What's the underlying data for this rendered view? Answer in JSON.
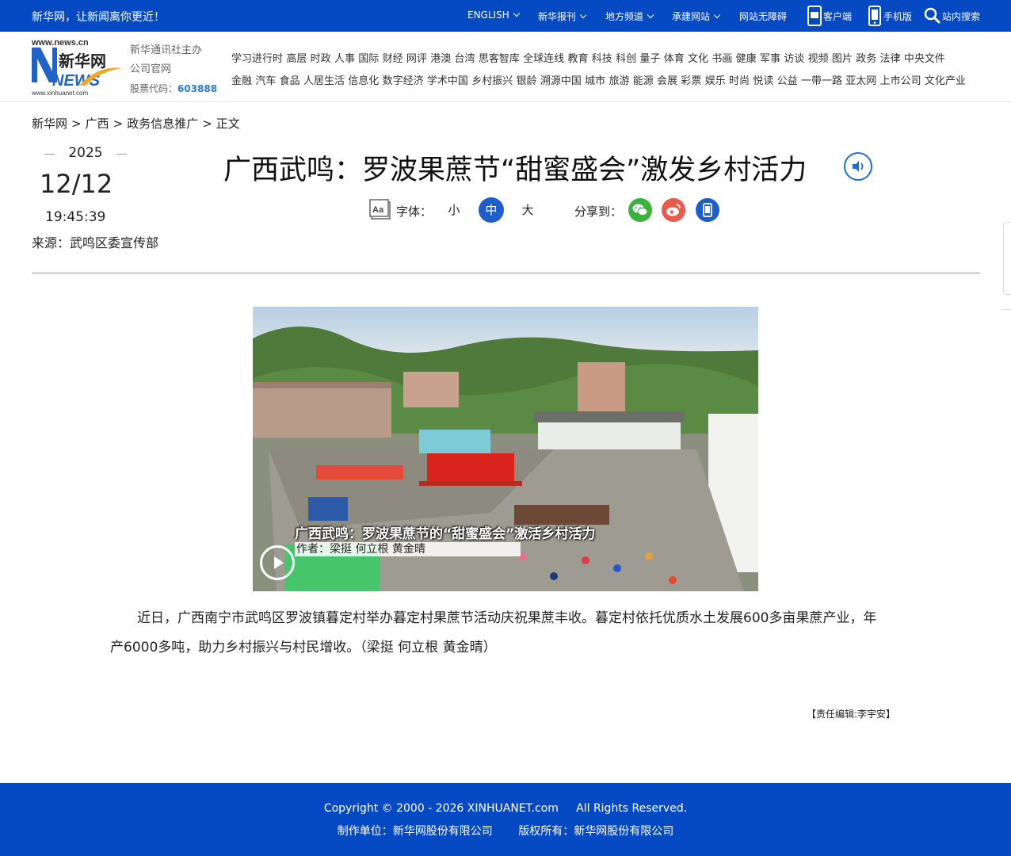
{
  "topbar": {
    "slogan": "新华网，让新闻离你更近！",
    "links": {
      "english": "ENGLISH",
      "publications": "新华报刊",
      "local": "地方频道",
      "construction": "承建网站",
      "accessible": "网站无障碍",
      "client": "客户端",
      "mobile": "手机版",
      "search": "站内搜索"
    }
  },
  "header": {
    "logo_text": {
      "domain": "www.news.cn",
      "cn": "新华网",
      "en": "NEWS",
      "sub": "www.xinhuanet.com"
    },
    "org_line1": "新华通讯社主办",
    "org_line2": "公司官网",
    "stock_label": "股票代码：",
    "stock_code": "603888",
    "nav_row1": [
      "学习进行时",
      "高层",
      "时政",
      "人事",
      "国际",
      "财经",
      "网评",
      "港澳",
      "台湾",
      "思客智库",
      "全球连线",
      "教育",
      "科技",
      "科创",
      "量子",
      "体育",
      "文化",
      "书画",
      "健康",
      "军事",
      "访谈",
      "视频",
      "图片",
      "政务",
      "法律",
      "中央文件"
    ],
    "nav_row2": [
      "金融",
      "汽车",
      "食品",
      "人居生活",
      "信息化",
      "数字经济",
      "学术中国",
      "乡村振兴",
      "银龄",
      "溯源中国",
      "城市",
      "旅游",
      "能源",
      "会展",
      "彩票",
      "娱乐",
      "时尚",
      "悦读",
      "公益",
      "一带一路",
      "亚太网",
      "上市公司",
      "文化产业"
    ]
  },
  "breadcrumb": {
    "items": [
      "新华网",
      "广西",
      "政务信息推广",
      "正文"
    ],
    "separator": ">"
  },
  "date": {
    "year": "2025",
    "day": "12/12",
    "time": "19:45:39",
    "source": "来源：武鸣区委宣传部"
  },
  "article": {
    "title": "广西武鸣：罗波果蔗节“甜蜜盛会”激发乡村活力",
    "font_label": "字体：",
    "font_small": "小",
    "font_mid": "中",
    "font_big": "大",
    "share_label": "分享到：",
    "video_caption": "广西武鸣：罗波果蔗节的“甜蜜盛会”激活乡村活力",
    "video_author": "作者：梁挺 何立根 黄金晴",
    "body": "近日，广西南宁市武鸣区罗波镇暮定村举办暮定村果蔗节活动庆祝果蔗丰收。暮定村依托优质水土发展600多亩果蔗产业，年产6000多吨，助力乡村振兴与村民增收。（梁挺 何立根 黄金晴）",
    "editor": "【责任编辑:李宇安】"
  },
  "footer": {
    "copyright": "Copyright © 2000 - 2026 XINHUANET.com     All Rights Reserved.",
    "producer": "制作单位：新华网股份有限公司",
    "rights": "版权所有：新华网股份有限公司"
  },
  "colors": {
    "brand_blue": "#0549c3",
    "accent_blue": "#1c5fc9",
    "wechat": "#39b33a",
    "weibo": "#ea5a4a"
  },
  "icons": [
    "chevron-down-icon",
    "client-app-icon",
    "mobile-phone-icon",
    "search-icon",
    "audio-icon",
    "font-size-icon",
    "wechat-icon",
    "weibo-icon",
    "mobile-share-icon",
    "play-icon"
  ]
}
